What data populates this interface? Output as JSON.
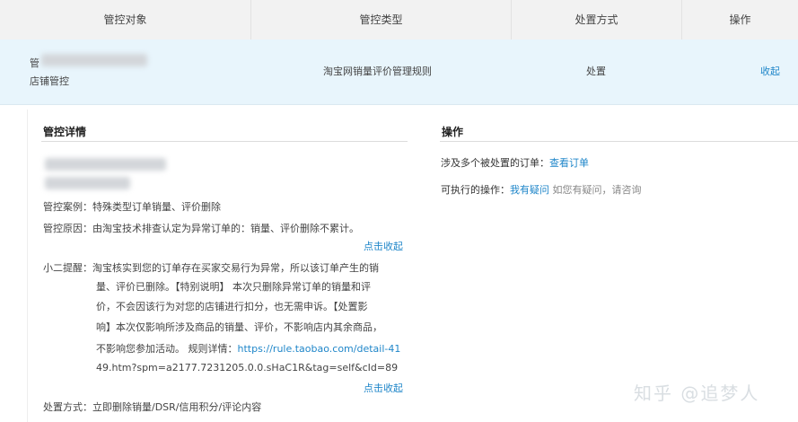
{
  "table": {
    "headers": [
      "管控对象",
      "管控类型",
      "处置方式",
      "操作"
    ],
    "row": {
      "object_prefix": "管",
      "object_line2": "店铺管控",
      "type": "淘宝网销量评价管理规则",
      "method": "处置",
      "action": "收起"
    }
  },
  "details": {
    "title": "管控详情",
    "case_label": "管控案例：",
    "case_value": "特殊类型订单销量、评价删除",
    "reason_label": "管控原因：",
    "reason_value": "由淘宝技术排查认定为异常订单的：销量、评价删除不累计。",
    "collapse1": "点击收起",
    "reminder_label": "小二提醒：",
    "reminder_lines": [
      "淘宝核实到您的订单存在买家交易行为异常，所以该订单产生的销",
      "量、评价已删除。【特别说明】 本次只删除异常订单的销量和评",
      "价，不会因该行为对您的店铺进行扣分，也无需申诉。【处置影",
      "响】本次仅影响所涉及商品的销量、评价，不影响店内其余商品，"
    ],
    "reminder_line5_text": "不影响您参加活动。 规则详情：",
    "reminder_link_part1": "https://rule.taobao.com/detail-41",
    "reminder_link_part2": "49.htm?spm=a2177.7231205.0.0.sHaC1R&tag=self&cId=89",
    "collapse2": "点击收起",
    "method_label": "处置方式：",
    "method_value": "立即删除销量/DSR/信用积分/评论内容"
  },
  "operations": {
    "title": "操作",
    "orders_label": "涉及多个被处置的订单：",
    "orders_link": "查看订单",
    "exec_label": "可执行的操作：",
    "exec_link": "我有疑问",
    "exec_hint": "如您有疑问，请咨询"
  },
  "watermark": "知乎 @追梦人"
}
